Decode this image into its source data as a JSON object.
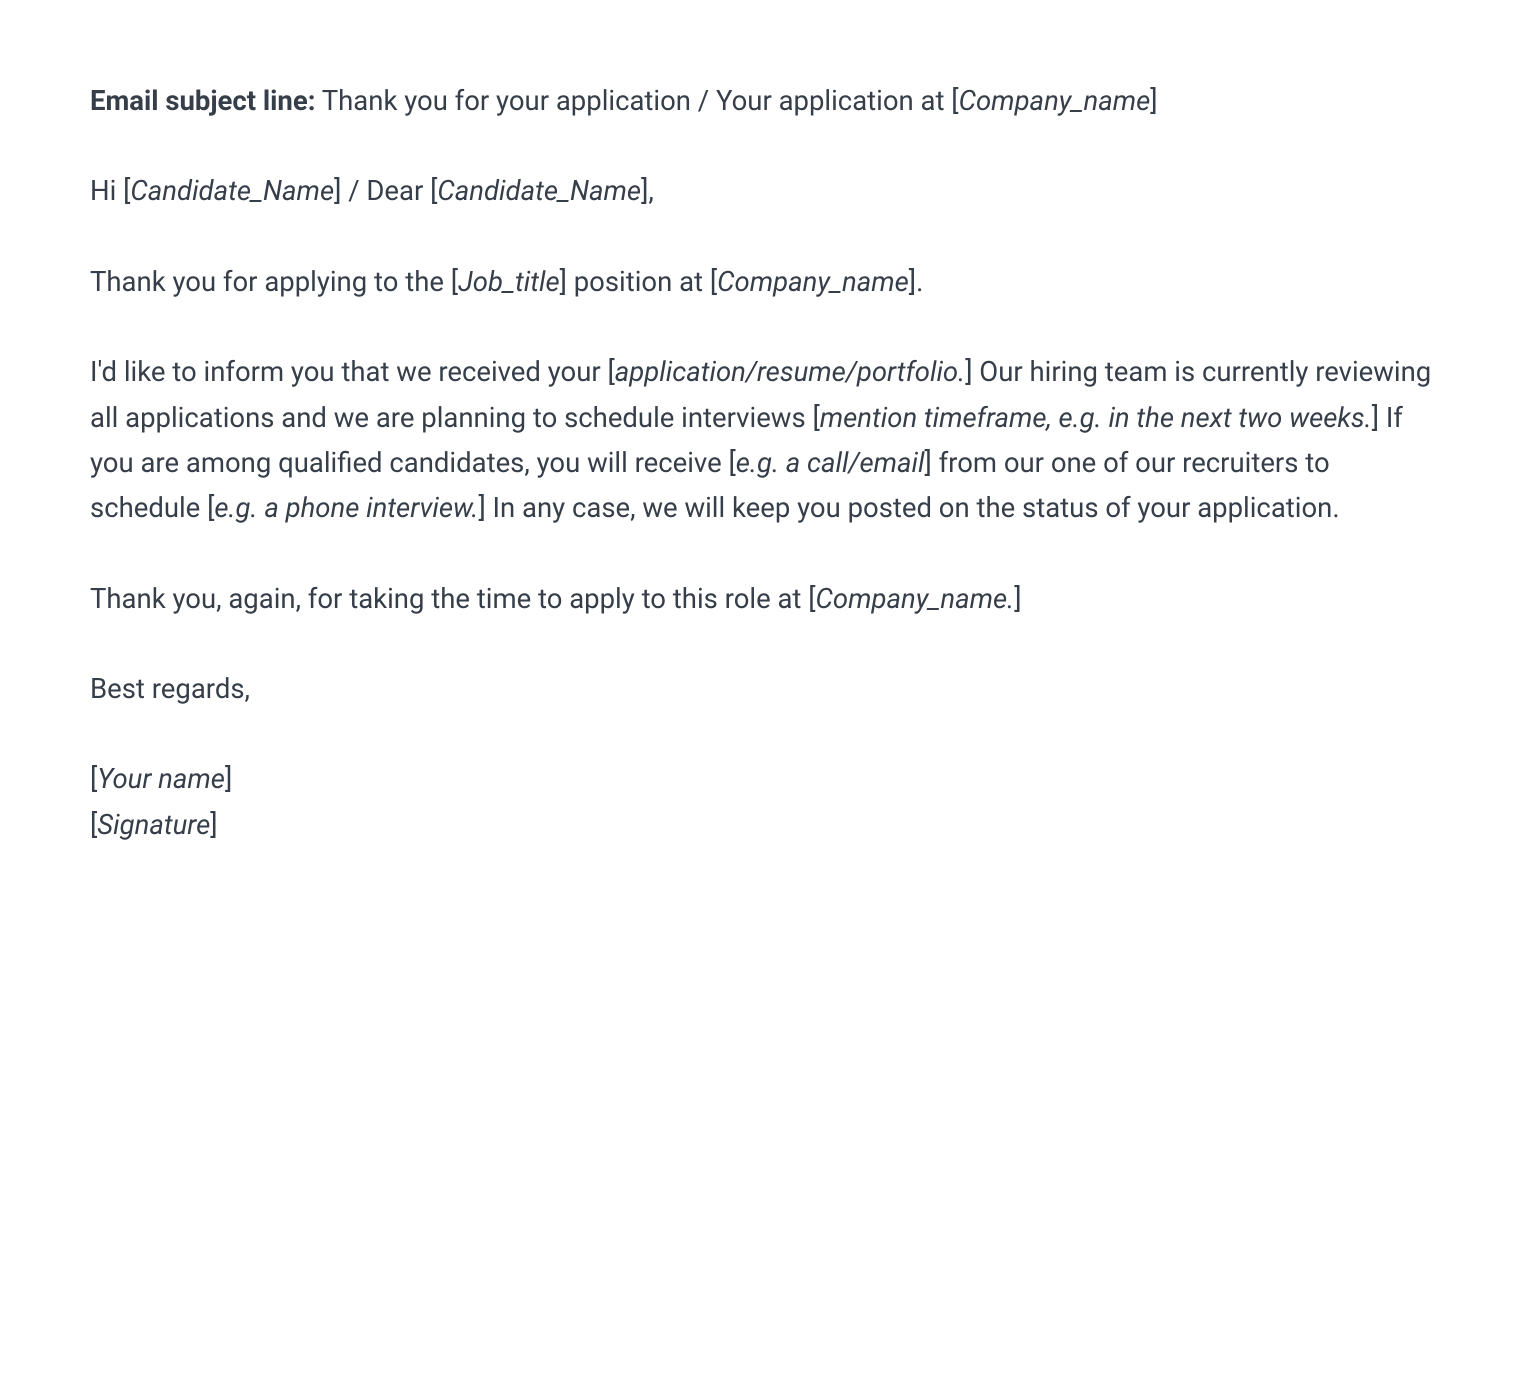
{
  "subject": {
    "label": "Email subject line:",
    "text_before": " Thank you for your application / Your application at [",
    "placeholder": "Company_name",
    "text_after": "]"
  },
  "greeting": {
    "t1": "Hi [",
    "p1": "Candidate_Name",
    "t2": "] / Dear [",
    "p2": "Candidate_Name",
    "t3": "],"
  },
  "p2": {
    "t1": "Thank you for applying to the [",
    "p1": "Job_title",
    "t2": "] position at [",
    "p2": "Company_name",
    "t3": "]."
  },
  "p3": {
    "t1": "I'd like to inform you that we received your [",
    "p1": "application/resume/portfolio.",
    "t2": "] Our hiring team is currently reviewing all applications and we are planning to schedule interviews [",
    "p2": "mention timeframe, e.g. in the next two weeks.",
    "t3": "] If you are among qualified candidates, you will receive [",
    "p3": "e.g. a call/email",
    "t4": "] from our one of our recruiters to schedule [",
    "p4": "e.g. a phone interview.",
    "t5": "] In any case, we will keep you posted on the status of your application."
  },
  "p4": {
    "t1": "Thank you, again, for taking the time to apply to this role at [",
    "p1": "Company_name.",
    "t2": "]"
  },
  "p5": {
    "t1": "Best regards,"
  },
  "p6": {
    "t1": "[",
    "p1": "Your name",
    "t2": "]",
    "t3": "[",
    "p2": "Signature",
    "t4": "]"
  }
}
